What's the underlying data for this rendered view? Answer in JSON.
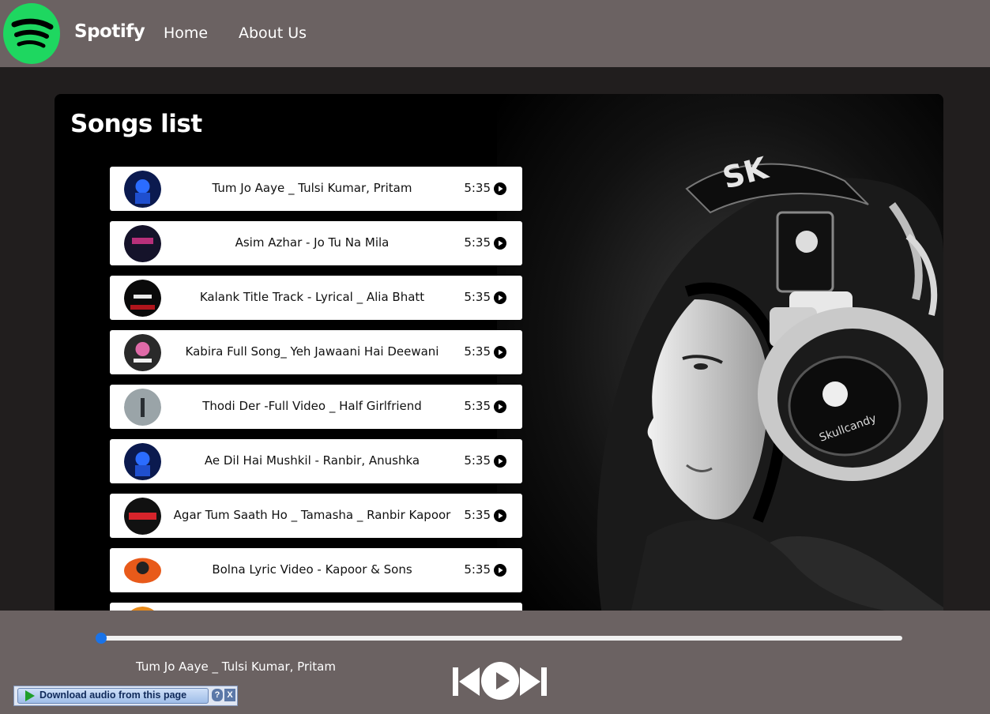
{
  "nav": {
    "brand": "Spotify",
    "links": [
      "Home",
      "About Us"
    ]
  },
  "colors": {
    "navbar": "#6b6262",
    "page": "#211e1e",
    "accent": "#1ed760",
    "progress": "#1a73e8"
  },
  "songs": {
    "title": "Songs list",
    "items": [
      {
        "name": "Tum Jo Aaye _ Tulsi Kumar, Pritam",
        "time": "5:35",
        "cover": "blue-figure"
      },
      {
        "name": "Asim Azhar - Jo Tu Na Mila",
        "time": "5:35",
        "cover": "purple-neon"
      },
      {
        "name": "Kalank Title Track - Lyrical _ Alia Bhatt",
        "time": "5:35",
        "cover": "they-mad"
      },
      {
        "name": "Kabira Full Song_ Yeh Jawaani Hai Deewani",
        "time": "5:35",
        "cover": "pink-walk"
      },
      {
        "name": "Thodi Der -Full Video _ Half Girlfriend",
        "time": "5:35",
        "cover": "grey-mist"
      },
      {
        "name": "Ae Dil Hai Mushkil - Ranbir, Anushka",
        "time": "5:35",
        "cover": "blue-figure"
      },
      {
        "name": "Agar Tum Saath Ho _ Tamasha _ Ranbir Kapoor",
        "time": "5:35",
        "cover": "back-it-up"
      },
      {
        "name": "Bolna Lyric Video - Kapoor & Sons",
        "time": "5:35",
        "cover": "orange-figure"
      },
      {
        "name": "",
        "time": "",
        "cover": "orange-partial"
      }
    ]
  },
  "player": {
    "now_playing": "Tum Jo Aaye _ Tulsi Kumar, Pritam",
    "progress": 0,
    "controls": [
      "previous-icon",
      "play-icon",
      "next-icon"
    ]
  },
  "download_widget": {
    "label": "Download audio from this page",
    "help": "?",
    "close": "X"
  }
}
